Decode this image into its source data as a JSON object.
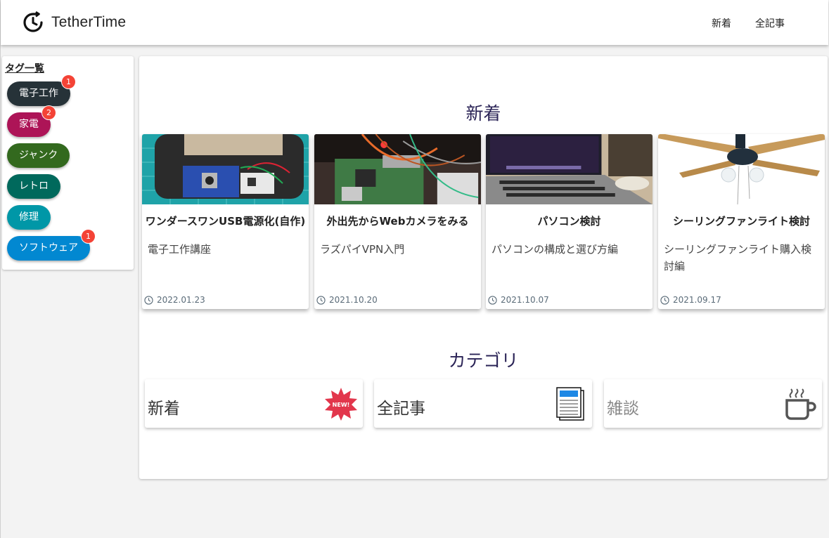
{
  "header": {
    "logo_text": "TetherTime",
    "nav": [
      "新着",
      "全記事"
    ]
  },
  "sidebar": {
    "title": "タグ一覧",
    "tags": [
      {
        "label": "電子工作",
        "badge": "1",
        "color": "#263238"
      },
      {
        "label": "家電",
        "badge": "2",
        "color": "#ad1457"
      },
      {
        "label": "ジャンク",
        "badge": "",
        "color": "#33691e"
      },
      {
        "label": "レトロ",
        "badge": "",
        "color": "#00695c"
      },
      {
        "label": "修理",
        "badge": "",
        "color": "#0097a7"
      },
      {
        "label": "ソフトウェア",
        "badge": "1",
        "color": "#0288d1"
      }
    ]
  },
  "main": {
    "new_title": "新着",
    "category_title": "カテゴリ",
    "cards": [
      {
        "title": "ワンダースワンUSB電源化(自作)",
        "subtitle": "電子工作講座",
        "date": "2022.01.23",
        "image_icon": "circuit-board-photo"
      },
      {
        "title": "外出先からWebカメラをみる",
        "subtitle": "ラズパイVPN入門",
        "date": "2021.10.20",
        "image_icon": "raspberry-pi-photo"
      },
      {
        "title": "パソコン検討",
        "subtitle": "パソコンの構成と選び方編",
        "date": "2021.10.07",
        "image_icon": "laptop-photo"
      },
      {
        "title": "シーリングファンライト検討",
        "subtitle": "シーリングファンライト購入検討編",
        "date": "2021.09.17",
        "image_icon": "ceiling-fan-photo"
      }
    ],
    "categories": [
      {
        "label": "新着",
        "icon": "new-badge-icon"
      },
      {
        "label": "全記事",
        "icon": "newspaper-icon"
      },
      {
        "label": "雑談",
        "icon": "coffee-cup-icon"
      }
    ]
  },
  "colors": {
    "accent_title": "#2a2356",
    "badge": "#f44336"
  }
}
